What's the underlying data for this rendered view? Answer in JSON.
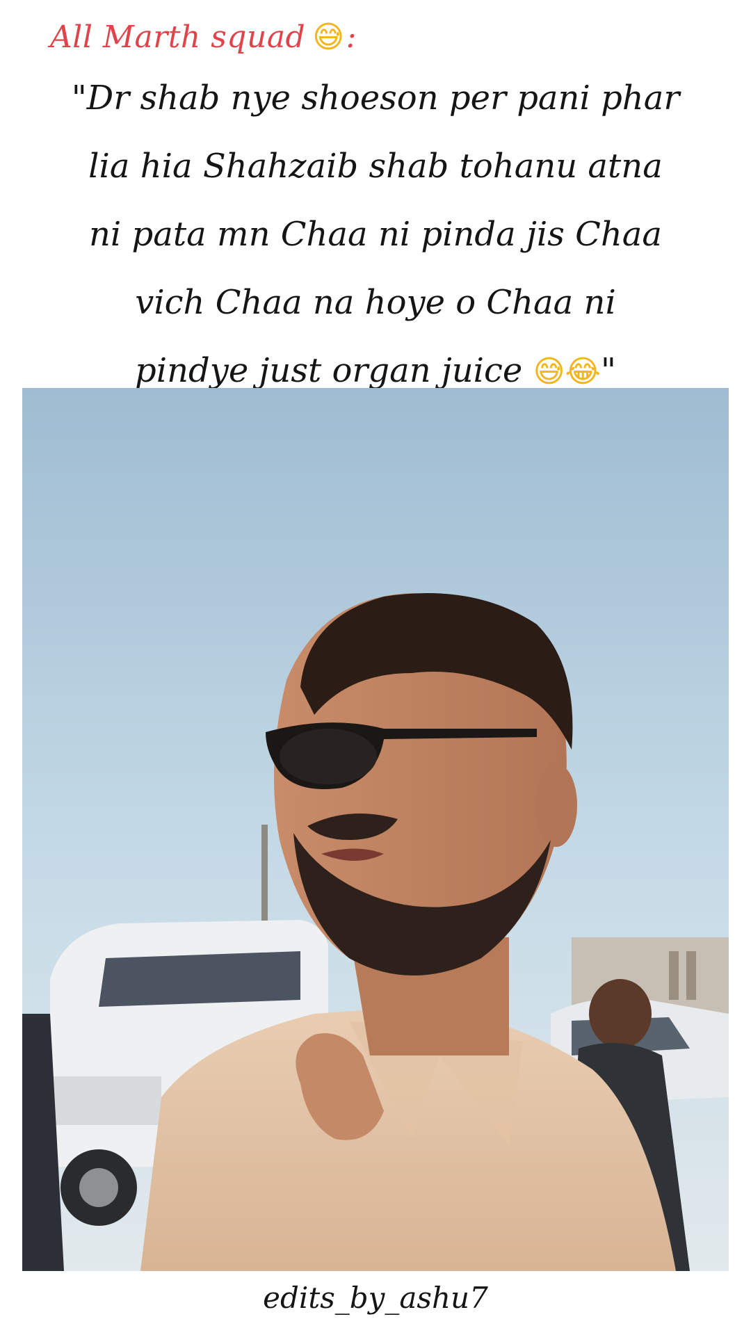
{
  "header": {
    "title": "All Marth squad",
    "suffix": ":",
    "emoji_icon": "grinning-sweat-icon"
  },
  "caption": {
    "lines": [
      "\"Dr shab nye shoeson per pani phar",
      "lia hia Shahzaib shab tohanu atna",
      "ni pata mn Chaa ni pinda jis Chaa",
      "vich Chaa na hoye o Chaa ni",
      "pindye just organ juice"
    ],
    "end_quote": "\"",
    "end_emojis": [
      "grinning-sweat-icon",
      "tears-of-joy-icon"
    ]
  },
  "footer": {
    "credit": "edits_by_ashu7"
  },
  "colors": {
    "header_text": "#e0434a",
    "body_text": "#151515",
    "background": "#ffffff"
  }
}
